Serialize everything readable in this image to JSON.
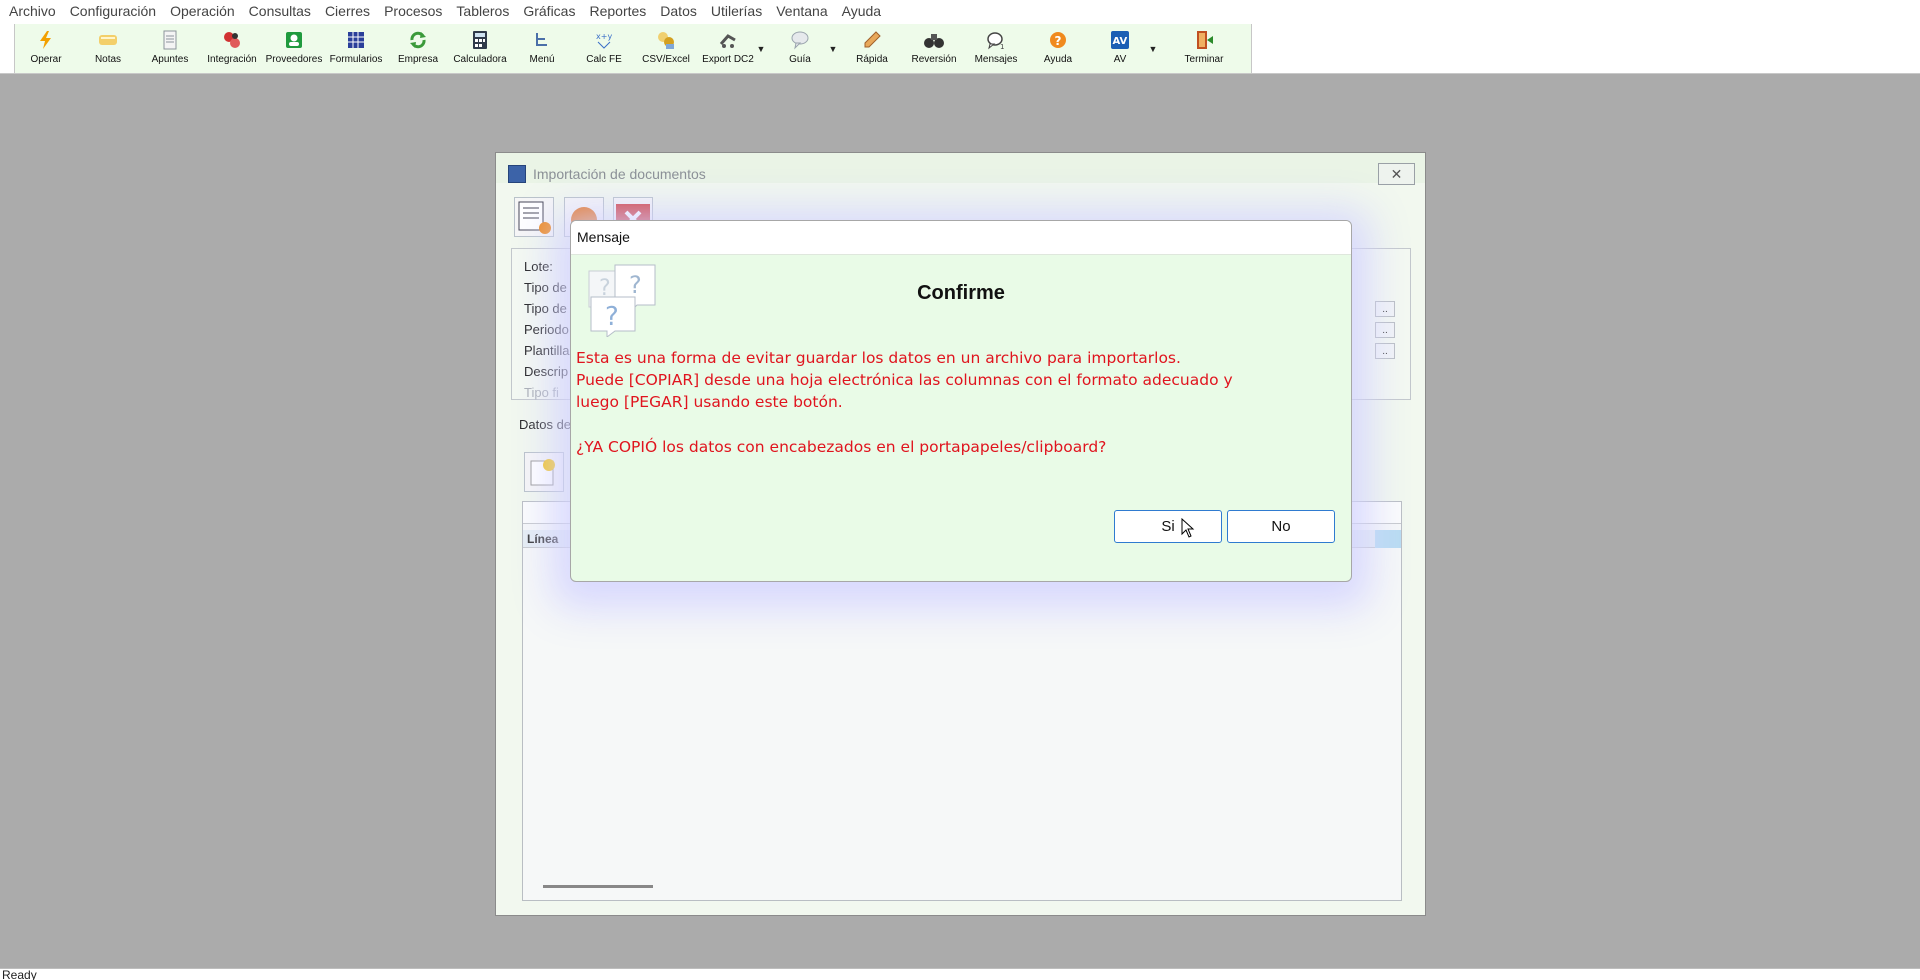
{
  "menu": [
    "Archivo",
    "Configuración",
    "Operación",
    "Consultas",
    "Cierres",
    "Procesos",
    "Tableros",
    "Gráficas",
    "Reportes",
    "Datos",
    "Utilerías",
    "Ventana",
    "Ayuda"
  ],
  "toolbar": {
    "buttons": [
      {
        "label": "Operar",
        "icon": "lightning-icon",
        "color": "#f2a000"
      },
      {
        "label": "Notas",
        "icon": "notes-icon",
        "color": "#e8b84a"
      },
      {
        "label": "Apuntes",
        "icon": "document-icon",
        "color": "#9aa4ad"
      },
      {
        "label": "Integración",
        "icon": "integration-icon",
        "color": "#d13232"
      },
      {
        "label": "Proveedores",
        "icon": "supplier-icon",
        "color": "#1f9a3d"
      },
      {
        "label": "Formularios",
        "icon": "forms-icon",
        "color": "#2a3f9a"
      },
      {
        "label": "Empresa",
        "icon": "refresh-icon",
        "color": "#3a9a3a"
      },
      {
        "label": "Calculadora",
        "icon": "calculator-icon",
        "color": "#2f3a4a"
      },
      {
        "label": "Menú",
        "icon": "menu-tree-icon",
        "color": "#4a6fa8"
      },
      {
        "label": "Calc FE",
        "icon": "calc-fe-icon",
        "color": "#3a6fc8"
      },
      {
        "label": "CSV/Excel",
        "icon": "csv-excel-icon",
        "color": "#d4a020"
      },
      {
        "label": "Export DC2",
        "icon": "export-icon",
        "color": "#555555"
      },
      {
        "label": "Guía",
        "icon": "chat-bubble-icon",
        "color": "#9aa4ad"
      },
      {
        "label": "Rápida",
        "icon": "pencil-icon",
        "color": "#d08a40"
      },
      {
        "label": "Reversión",
        "icon": "binoculars-icon",
        "color": "#333333"
      },
      {
        "label": "Mensajes",
        "icon": "message-icon",
        "color": "#444444"
      },
      {
        "label": "Ayuda",
        "icon": "help-icon",
        "color": "#f08a1e"
      },
      {
        "label": "AV",
        "icon": "av-icon",
        "color": "#1a5fb4"
      },
      {
        "label": "Terminar",
        "icon": "exit-icon",
        "color": "#c05020"
      }
    ]
  },
  "child_window": {
    "title": "Importación de documentos",
    "close_label": "✕",
    "fields": [
      {
        "label": "Lote:"
      },
      {
        "label": "Tipo de"
      },
      {
        "label": "Tipo de"
      },
      {
        "label": "Periodo"
      },
      {
        "label": "Plantilla"
      },
      {
        "label": "Descrip"
      },
      {
        "label": "Tipo fi"
      }
    ],
    "more_button": "..",
    "datos_label": "Datos de",
    "grid_header": "Línea"
  },
  "dialog": {
    "title": "Mensaje",
    "heading": "Confirme",
    "lines": [
      "Esta es una forma de evitar guardar los datos en un archivo para importarlos.",
      "Puede [COPIAR] desde una hoja electrónica las columnas con el formato adecuado y",
      "luego [PEGAR] usando este botón.",
      "¿YA COPIÓ los datos con encabezados en el portapapeles/clipboard?"
    ],
    "yes_label": "Si",
    "no_label": "No",
    "message_color": "#e0141e"
  },
  "status": "Ready"
}
